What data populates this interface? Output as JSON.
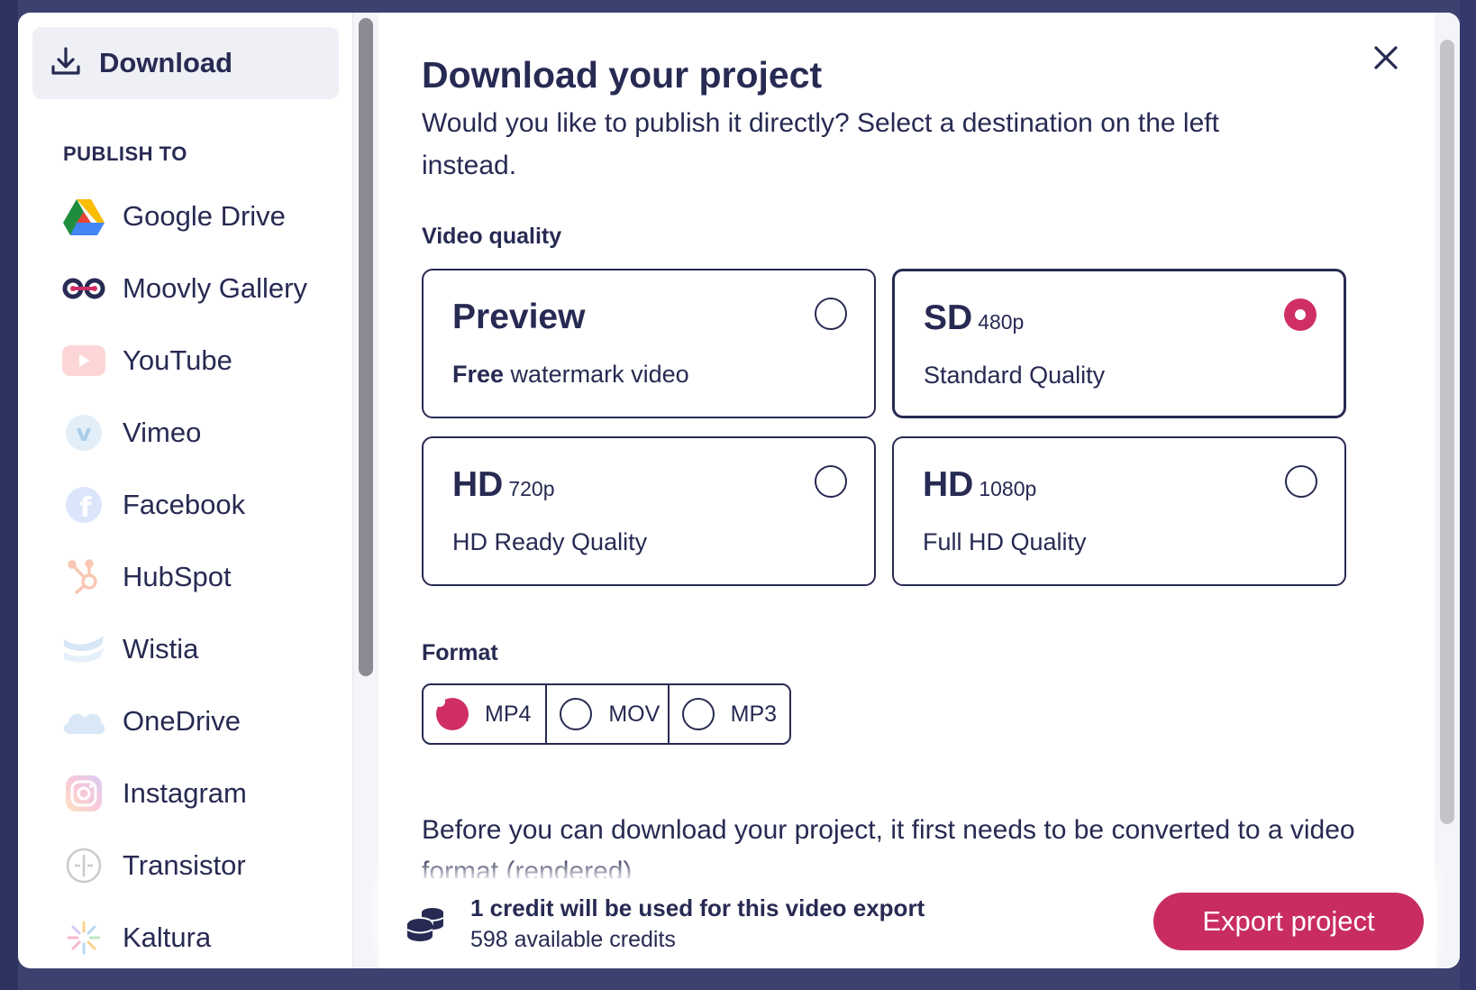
{
  "sidebar": {
    "download_label": "Download",
    "section_title": "PUBLISH TO",
    "items": [
      {
        "label": "Google Drive",
        "icon": "google-drive-icon"
      },
      {
        "label": "Moovly Gallery",
        "icon": "moovly-icon"
      },
      {
        "label": "YouTube",
        "icon": "youtube-icon"
      },
      {
        "label": "Vimeo",
        "icon": "vimeo-icon"
      },
      {
        "label": "Facebook",
        "icon": "facebook-icon"
      },
      {
        "label": "HubSpot",
        "icon": "hubspot-icon"
      },
      {
        "label": "Wistia",
        "icon": "wistia-icon"
      },
      {
        "label": "OneDrive",
        "icon": "onedrive-icon"
      },
      {
        "label": "Instagram",
        "icon": "instagram-icon"
      },
      {
        "label": "Transistor",
        "icon": "transistor-icon"
      },
      {
        "label": "Kaltura",
        "icon": "kaltura-icon"
      }
    ]
  },
  "main": {
    "title": "Download your project",
    "subtitle": "Would you like to publish it directly? Select a destination on the left instead.",
    "quality_label": "Video quality",
    "qualities": [
      {
        "name": "Preview",
        "res": "",
        "desc_bold": "Free",
        "desc": " watermark video",
        "selected": false
      },
      {
        "name": "SD",
        "res": "480p",
        "desc_bold": "",
        "desc": "Standard Quality",
        "selected": true
      },
      {
        "name": "HD",
        "res": "720p",
        "desc_bold": "",
        "desc": "HD Ready Quality",
        "selected": false
      },
      {
        "name": "HD",
        "res": "1080p",
        "desc_bold": "",
        "desc": "Full HD Quality",
        "selected": false
      }
    ],
    "format_label": "Format",
    "formats": [
      {
        "label": "MP4",
        "selected": true
      },
      {
        "label": "MOV",
        "selected": false
      },
      {
        "label": "MP3",
        "selected": false
      }
    ],
    "render_note": "Before you can download your project, it first needs to be converted to a video format (rendered)"
  },
  "footer": {
    "credit_main": "1 credit will be used for this video export",
    "credit_sub": "598 available credits",
    "export_label": "Export project"
  },
  "colors": {
    "accent": "#c92d5f",
    "text": "#272a52",
    "backdrop": "#3d4170"
  }
}
